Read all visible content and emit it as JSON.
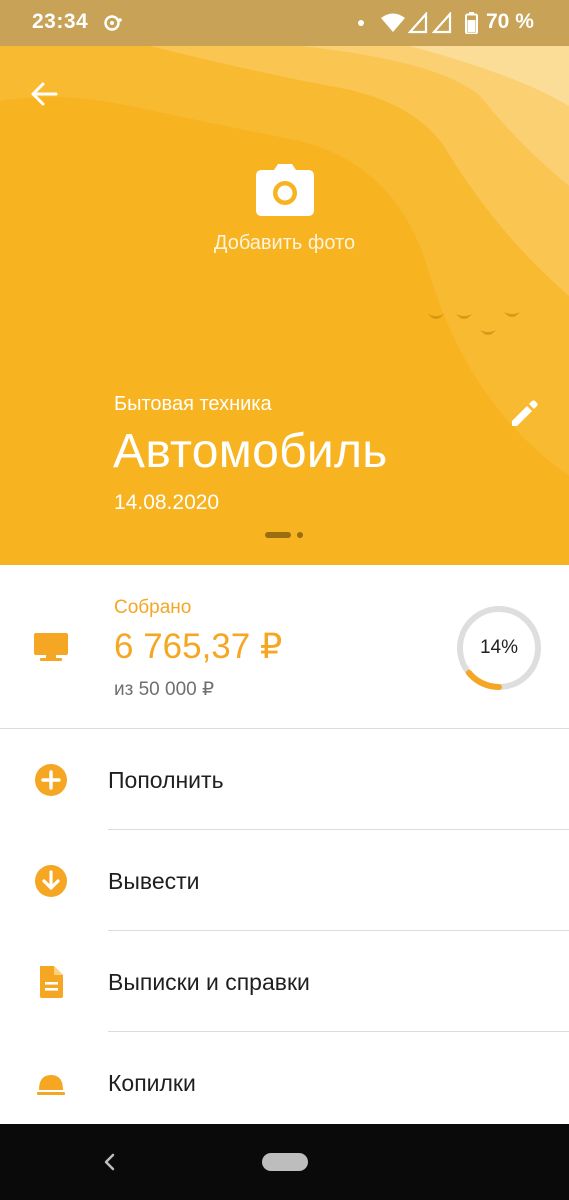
{
  "status_bar": {
    "time": "23:34",
    "battery_percent": "70 %",
    "icons": [
      "notification-icon",
      "dot-icon",
      "wifi-icon",
      "signal-icon",
      "signal-icon",
      "battery-icon"
    ]
  },
  "header": {
    "background_color": "#f7b320",
    "add_photo_label": "Добавить фото",
    "category": "Бытовая техника",
    "title": "Автомобиль",
    "date": "14.08.2020",
    "icons": [
      "back-arrow-icon",
      "camera-icon",
      "pencil-icon"
    ],
    "pager": {
      "pages": 2,
      "active": 1
    }
  },
  "summary": {
    "collected_label": "Собрано",
    "collected_amount": "6 765,37 ₽",
    "goal_text": "из 50 000 ₽",
    "progress_label": "14%",
    "progress_fraction": 0.14,
    "accent_color": "#f5a623",
    "icon": "monitor-icon"
  },
  "menu": {
    "items": [
      {
        "label": "Пополнить",
        "icon": "plus-circle-icon"
      },
      {
        "label": "Вывести",
        "icon": "arrow-down-circle-icon"
      },
      {
        "label": "Выписки и справки",
        "icon": "document-icon"
      },
      {
        "label": "Копилки",
        "icon": "piggy-bank-icon"
      }
    ]
  },
  "nav_bar": {
    "icons": [
      "nav-back-icon",
      "nav-home-pill"
    ]
  }
}
